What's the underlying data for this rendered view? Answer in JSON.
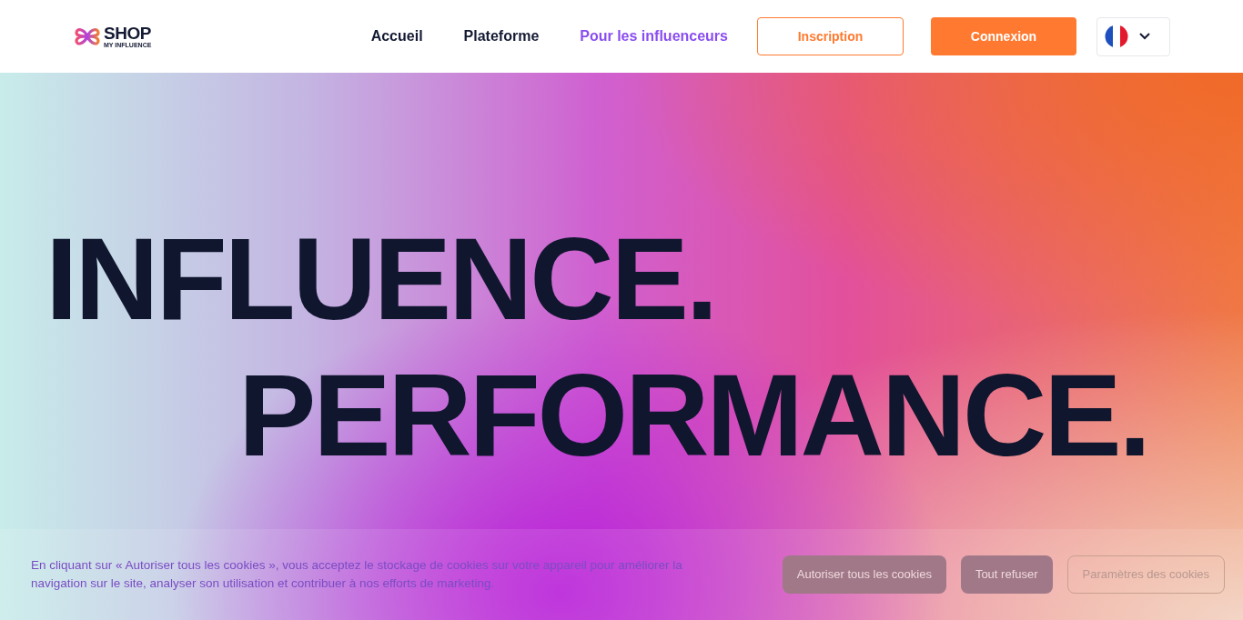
{
  "header": {
    "logo": {
      "title": "SHOP",
      "subtitle": "MY INFLUENCE"
    },
    "nav": [
      {
        "label": "Accueil",
        "selected": false
      },
      {
        "label": "Plateforme",
        "selected": false
      },
      {
        "label": "Pour les influenceurs",
        "selected": true
      }
    ],
    "signup_button": "Inscription",
    "login_button": "Connexion"
  },
  "hero": {
    "lines": [
      "INFLUENCE.",
      "PERFORMANCE."
    ]
  },
  "cookie_banner": {
    "text": "En cliquant sur « Autoriser tous les cookies », vous acceptez le stockage de cookies sur votre appareil pour améliorer la navigation sur le site, analyser son utilisation et contribuer à nos efforts de marketing.",
    "buttons": [
      {
        "label": "Autoriser tous les cookies",
        "kind": "filled"
      },
      {
        "label": "Tout refuser",
        "kind": "filled"
      },
      {
        "label": "Paramètres des cookies",
        "kind": "outline"
      }
    ]
  }
}
